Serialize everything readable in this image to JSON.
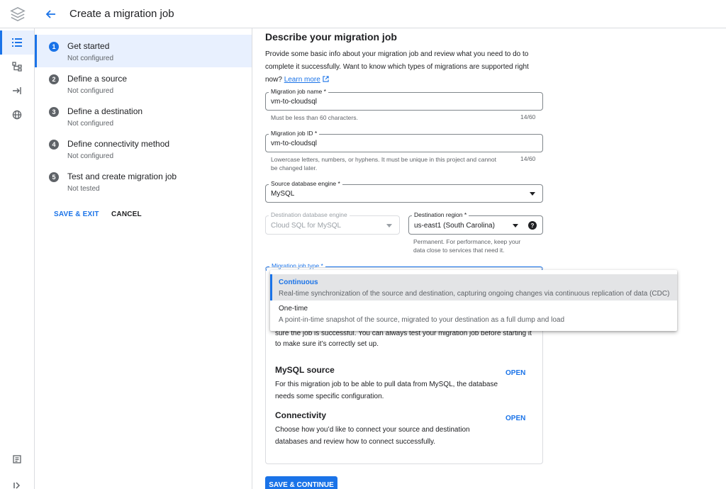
{
  "header": {
    "title": "Create a migration job"
  },
  "rail": {
    "items": [
      "list-icon",
      "tree-icon",
      "migrate-icon",
      "globe-icon"
    ],
    "bottom": [
      "release-notes-icon",
      "expand-icon"
    ]
  },
  "steps": [
    {
      "num": "1",
      "title": "Get started",
      "status": "Not configured",
      "active": true
    },
    {
      "num": "2",
      "title": "Define a source",
      "status": "Not configured",
      "active": false
    },
    {
      "num": "3",
      "title": "Define a destination",
      "status": "Not configured",
      "active": false
    },
    {
      "num": "4",
      "title": "Define connectivity method",
      "status": "Not configured",
      "active": false
    },
    {
      "num": "5",
      "title": "Test and create migration job",
      "status": "Not tested",
      "active": false
    }
  ],
  "actions": {
    "save_exit": "SAVE & EXIT",
    "cancel": "CANCEL"
  },
  "main": {
    "heading": "Describe your migration job",
    "intro": "Provide some basic info about your migration job and review what you need to do to complete it successfully. Want to know which types of migrations are supported right now?",
    "learn_more": "Learn more",
    "job_name": {
      "label": "Migration job name *",
      "value": "vm-to-cloudsql",
      "hint": "Must be less than 60 characters.",
      "count": "14/60"
    },
    "job_id": {
      "label": "Migration job ID *",
      "value": "vm-to-cloudsql",
      "hint_line1": "Lowercase letters, numbers, or hyphens. It must be unique in this project and cannot",
      "hint_line2": "be changed later.",
      "count": "14/60"
    },
    "source_engine": {
      "label": "Source database engine *",
      "value": "MySQL"
    },
    "dest_engine": {
      "label": "Destination database engine",
      "value": "Cloud SQL for MySQL"
    },
    "dest_region": {
      "label": "Destination region *",
      "value": "us-east1 (South Carolina)",
      "hint_line1": "Permanent. For performance, keep your",
      "hint_line2": "data close to services that need it."
    },
    "job_type": {
      "label": "Migration job type *"
    },
    "card": {
      "partial_line1": "sure the job is successful. You can always test your migration job before starting it",
      "partial_line2": "to make sure it’s correctly set up.",
      "mysql_title": "MySQL source",
      "mysql_body_line1": "For this migration job to be able to pull data from MySQL, the database",
      "mysql_body_line2": "needs some specific configuration.",
      "conn_title": "Connectivity",
      "conn_body_line1": "Choose how you’d like to connect your source and destination",
      "conn_body_line2": "databases and review how to connect successfully.",
      "open_label": "OPEN"
    },
    "save_continue": "SAVE & CONTINUE"
  },
  "dropdown": {
    "options": [
      {
        "title": "Continuous",
        "desc": "Real-time synchronization of the source and destination, capturing ongoing changes via continuous replication of data (CDC)",
        "selected": true
      },
      {
        "title": "One-time",
        "desc": "A point-in-time snapshot of the source, migrated to your destination as a full dump and load",
        "selected": false
      }
    ]
  },
  "colors": {
    "accent": "#1a73e8",
    "selected_bg": "#e8f0fe",
    "text": "#202124",
    "muted": "#5f6368"
  }
}
